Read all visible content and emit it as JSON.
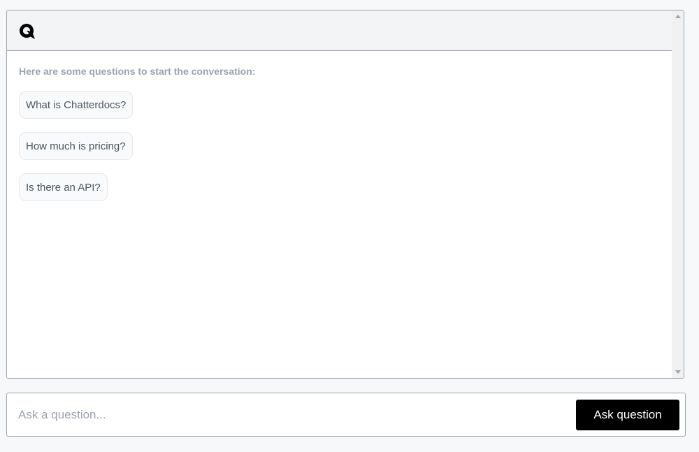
{
  "header": {
    "logo_icon": "chat-bubble-logo-icon"
  },
  "messages": {
    "intro": "Here are some questions to start the conversation:",
    "suggestions": [
      "What is Chatterdocs?",
      "How much is pricing?",
      "Is there an API?"
    ]
  },
  "input": {
    "placeholder": "Ask a question...",
    "value": "",
    "submit_label": "Ask question"
  },
  "colors": {
    "background": "#f7f8fa",
    "header": "#f3f4f6",
    "border": "#9aa3ad",
    "muted_text": "#9ca3af",
    "button": "#000000"
  }
}
